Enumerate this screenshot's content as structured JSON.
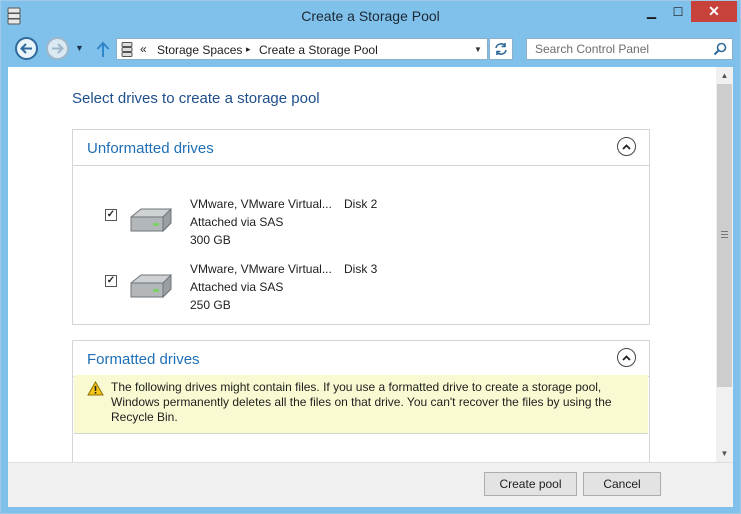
{
  "window": {
    "title": "Create a Storage Pool",
    "minimize_glyph": "▁",
    "maximize_glyph": "☐",
    "close_glyph": "✕"
  },
  "nav": {
    "back_icon": "arrow-left-icon",
    "forward_icon": "arrow-right-icon",
    "up_icon": "arrow-up-icon",
    "address_prefix": "«",
    "breadcrumb": [
      "Storage Spaces",
      "Create a Storage Pool"
    ],
    "separator": "▸",
    "dropdown_glyph": "▼",
    "recent_glyph": "▼"
  },
  "search": {
    "placeholder": "Search Control Panel"
  },
  "page": {
    "title": "Select drives to create a storage pool"
  },
  "unformatted": {
    "title": "Unformatted drives",
    "drives": [
      {
        "name": "VMware, VMware Virtual...",
        "disk": "Disk 2",
        "attach": "Attached via SAS",
        "size": "300 GB",
        "checked": true
      },
      {
        "name": "VMware, VMware Virtual...",
        "disk": "Disk 3",
        "attach": "Attached via SAS",
        "size": "250 GB",
        "checked": true
      }
    ]
  },
  "formatted": {
    "title": "Formatted drives",
    "warning": "The following drives might contain files. If you use a formatted drive to create a storage pool, Windows permanently deletes all the files on that drive. You can't recover the files by using the Recycle Bin."
  },
  "checkmark": "✓",
  "footer": {
    "create_label": "Create pool",
    "cancel_label": "Cancel"
  },
  "colors": {
    "title_bar": "#7fc1ea",
    "link_blue": "#1e6fb5",
    "heading_blue": "#1e4e8c",
    "warning_bg": "#fafad2",
    "close_red": "#c7423b"
  }
}
